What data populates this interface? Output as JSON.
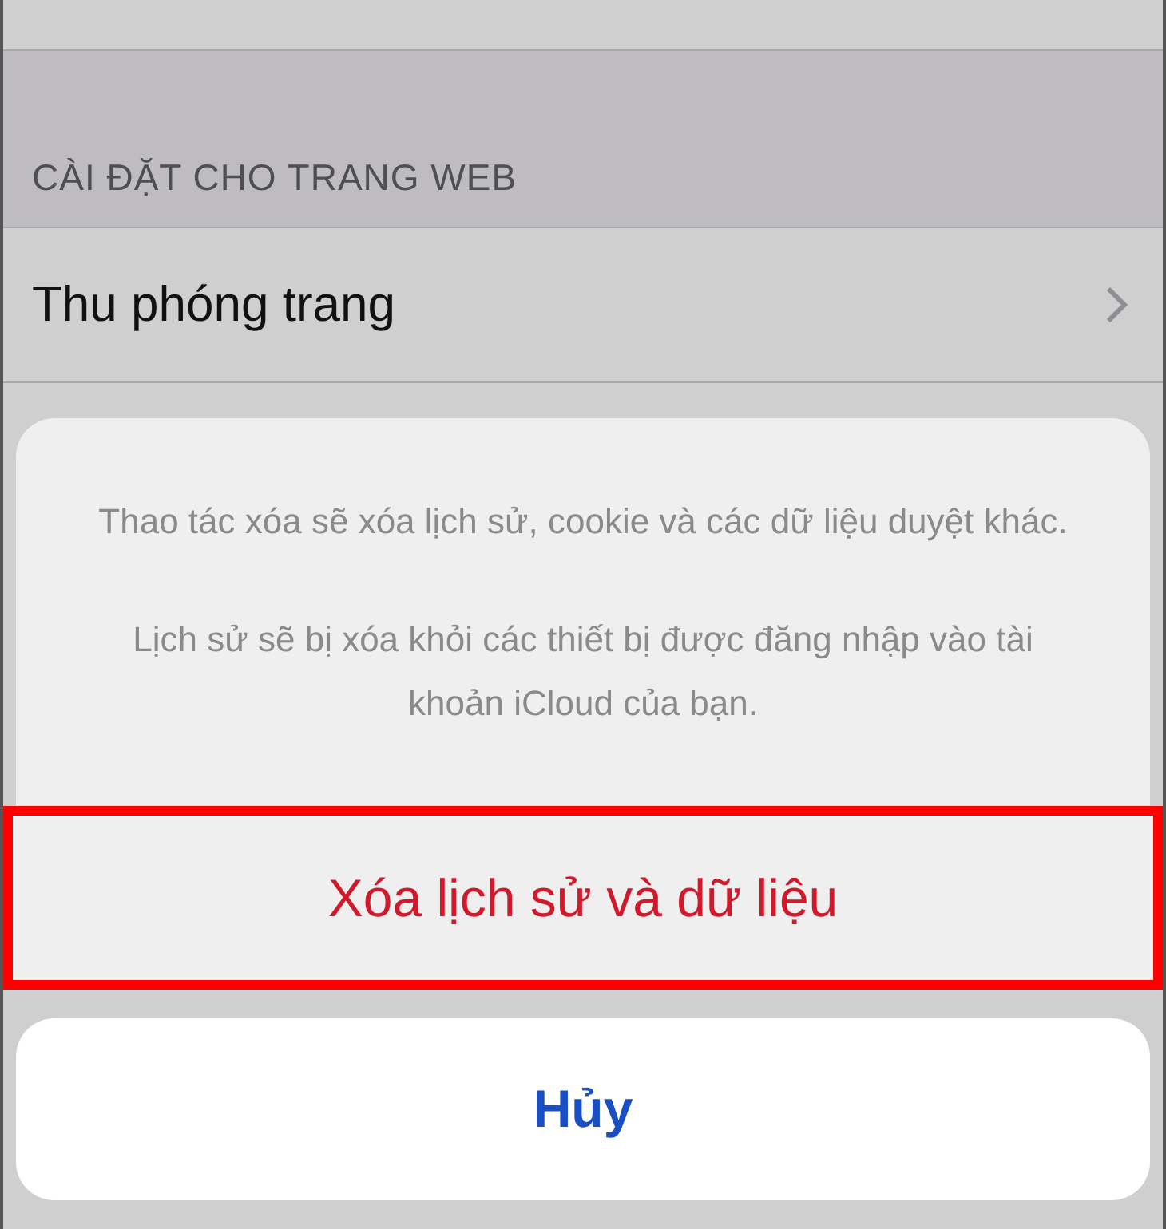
{
  "settings": {
    "section_header": "CÀI ĐẶT CHO TRANG WEB",
    "rows": [
      {
        "label": "Thu phóng trang"
      }
    ]
  },
  "action_sheet": {
    "message": [
      "Thao tác xóa sẽ xóa lịch sử, cookie và các dữ liệu duyệt khác.",
      "Lịch sử sẽ bị xóa khỏi các thiết bị được đăng nhập vào tài khoản iCloud của bạn."
    ],
    "actions": [
      {
        "label": "Xóa lịch sử và dữ liệu",
        "kind": "destructive",
        "highlighted": true
      }
    ],
    "cancel": "Hủy"
  }
}
